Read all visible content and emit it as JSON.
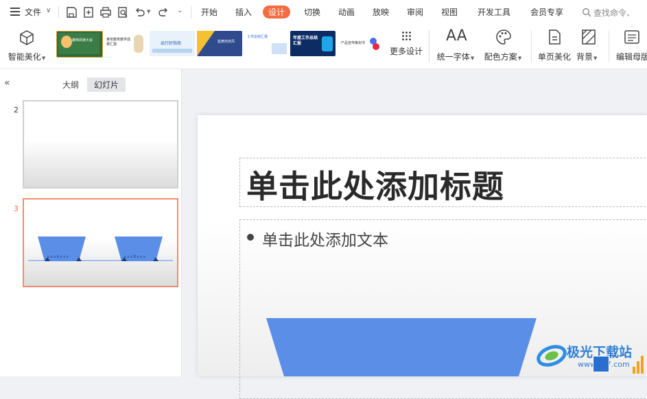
{
  "menubar": {
    "file_label": "文件",
    "tabs": [
      "开始",
      "插入",
      "设计",
      "切换",
      "动画",
      "放映",
      "审阅",
      "视图",
      "开发工具",
      "会员专享"
    ],
    "active_tab": "设计",
    "search_placeholder": "查找命令、",
    "accent_color": "#f36c42"
  },
  "ribbon": {
    "smart_beautify": "智能美化",
    "more_design": "更多设计",
    "unify_font": "统一字体",
    "color_scheme": "配色方案",
    "page_beautify": "单页美化",
    "background": "背景",
    "edit_master": "编辑母版",
    "template_texts": {
      "t1": "趣味阅读大会",
      "t2": "某校教育教学成果汇报",
      "t3": "出行好指南",
      "t4": "蓝黄商务风",
      "t5": "工作总结汇报",
      "t6": "年度工作总结汇报",
      "t7": "产品宣传策划书"
    }
  },
  "leftpanel": {
    "collapse_icon": "double-chevron-left-icon",
    "tab_outline": "大纲",
    "tab_slides": "幻灯片",
    "slides": [
      {
        "number": "2"
      },
      {
        "number": "3",
        "selected": true,
        "mini_left_text": "x x x A x x x",
        "mini_right_text": "x x x B x x x"
      }
    ],
    "selected_border_color": "#f08a6c"
  },
  "slide": {
    "title": "单击此处添加标题",
    "body_text": "单击此处添加文本",
    "shape_color": "#5b8ee6"
  },
  "watermark": {
    "text": "极光下载站",
    "url": "www.xz7.com"
  }
}
